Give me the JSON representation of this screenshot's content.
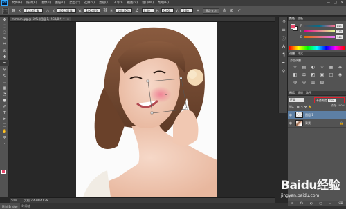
{
  "menubar": {
    "logo": "Ps",
    "items": [
      "文件(F)",
      "编辑(E)",
      "图像(I)",
      "图层(L)",
      "类型(Y)",
      "选择(S)",
      "滤镜(T)",
      "3D(D)",
      "视图(V)",
      "窗口(W)",
      "帮助(H)"
    ],
    "window_controls": [
      "—",
      "□",
      "✕"
    ]
  },
  "options": {
    "x_label": "X:",
    "x_value": "713.63 像",
    "y_label": "Y:",
    "y_value": "430.50 像",
    "w_label": "W:",
    "w_value": "100.00%",
    "h_label": "H:",
    "h_value": "100.00%",
    "angle_value": "0.00",
    "hskew_label": "H:",
    "hskew_value": "0.00",
    "vskew_label": "V:",
    "vskew_value": "0.00",
    "interp_value": "两次立方",
    "commit_icon": "✓",
    "cancel_icon": "⊘"
  },
  "document": {
    "tab_title": "mmmm.jpg @ 50% (图层 1, RGB/8#) *",
    "zoom": "50%",
    "doc_size": "文档:2.43M/4.62M"
  },
  "minibridge": {
    "tabs": [
      "Mini Bridge",
      "时间轴"
    ]
  },
  "panels": {
    "color": {
      "tabs": [
        "颜色",
        "色板"
      ],
      "channels": [
        {
          "name": "R",
          "value": "229"
        },
        {
          "name": "G",
          "value": "113"
        },
        {
          "name": "B",
          "value": "144"
        }
      ],
      "fg_color": "#e8466a",
      "bg_color": "#ffffff"
    },
    "adjust": {
      "tabs": [
        "调整",
        "样式"
      ],
      "title": "添加调整",
      "icons": [
        "☼",
        "▤",
        "◐",
        "▽",
        "▦",
        "◈",
        "◧",
        "⚖",
        "◩",
        "▣",
        "◫",
        "◉",
        "◍",
        "◎",
        "▥",
        "▧",
        "◪"
      ]
    },
    "layers": {
      "tabs": [
        "图层",
        "通道",
        "路径"
      ],
      "kind_label": "类型",
      "blend_mode": "正常",
      "opacity_label": "不透明度:",
      "opacity_value": "75%",
      "lock_label": "锁定:",
      "fill_label": "填充: 100%",
      "items": [
        {
          "name": "图层 1",
          "selected": true
        },
        {
          "name": "背景",
          "selected": false
        }
      ],
      "bottom_icons": [
        "⊝",
        "fx",
        "◐",
        "▢",
        "▭",
        "⌫"
      ]
    }
  },
  "watermark": {
    "brand": "Baidu经验",
    "url": "jingyan.baidu.com"
  }
}
